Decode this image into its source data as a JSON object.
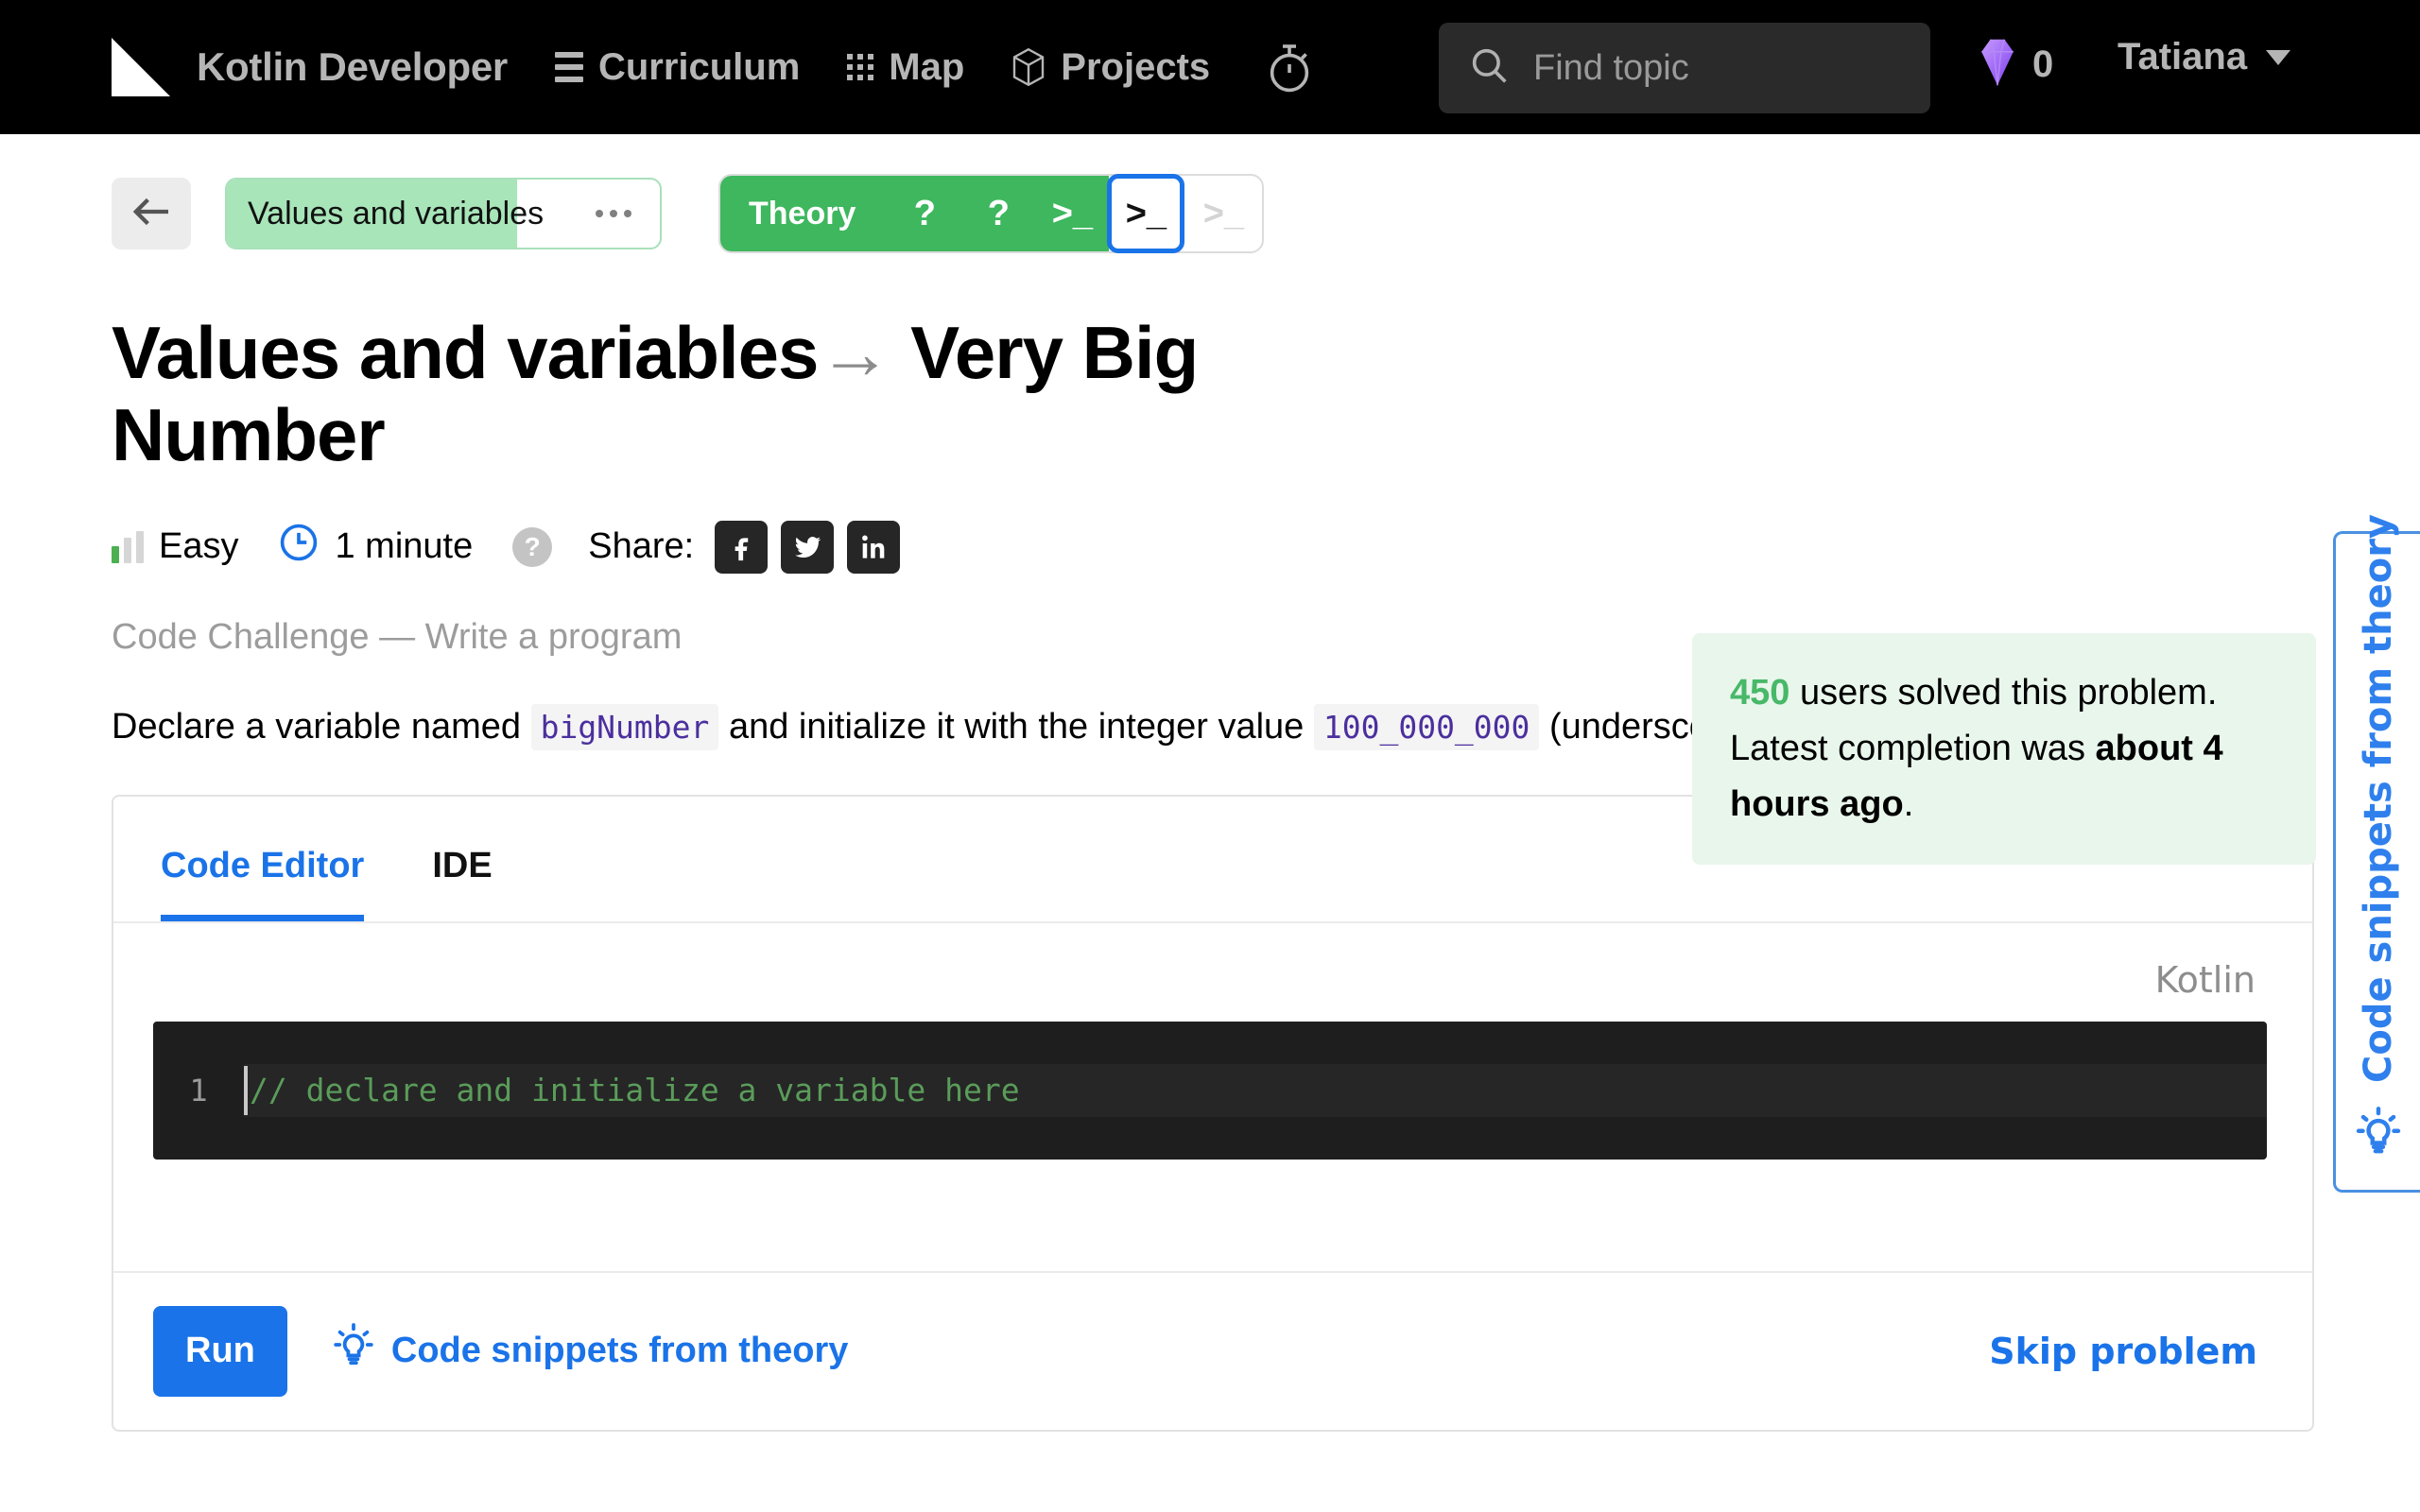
{
  "navbar": {
    "logo_icon": "hyperskill-logo-icon",
    "brand": "Kotlin Developer",
    "items": [
      {
        "label": "Curriculum",
        "icon": "hamburger-icon"
      },
      {
        "label": "Map",
        "icon": "grid-dots-icon"
      },
      {
        "label": "Projects",
        "icon": "cube-icon"
      }
    ],
    "timer_icon": "stopwatch-icon",
    "search": {
      "icon": "search-icon",
      "placeholder": "Find topic",
      "value": ""
    },
    "gems": {
      "icon": "gem-icon",
      "count": "0",
      "color": "#a368f0"
    },
    "user": {
      "name": "Tatiana",
      "caret_icon": "chevron-down-icon"
    }
  },
  "stepbar": {
    "back_icon": "arrow-left-icon",
    "topic_chip": {
      "label": "Values and variables",
      "progress_percent": 67,
      "more_icon": "ellipsis-icon"
    },
    "steps": {
      "theory_label": "Theory",
      "done_icons": [
        "question-mark-icon",
        "question-mark-icon",
        "terminal-prompt-icon"
      ],
      "current_icon": "terminal-prompt-icon",
      "next_icon": "terminal-prompt-icon"
    }
  },
  "main": {
    "title_topic": "Values and variables",
    "title_arrow": "→",
    "title_step": "Very Big Number",
    "meta": {
      "difficulty_icon": "difficulty-bars-icon",
      "difficulty": "Easy",
      "time_icon": "clock-icon",
      "time": "1 minute",
      "help_icon": "question-circle-icon",
      "share_label": "Share:",
      "share": [
        {
          "name": "facebook-icon",
          "glyph": "f"
        },
        {
          "name": "twitter-icon",
          "glyph": "t"
        },
        {
          "name": "linkedin-icon",
          "glyph": "in"
        }
      ]
    },
    "challenge_kind": "Code Challenge — Write a program",
    "task": {
      "part1": "Declare a variable named ",
      "code1": "bigNumber",
      "part2": " and initialize it with the integer value ",
      "code2": "100_000_000",
      "part3": " (underscores are admissible here)."
    }
  },
  "solved_box": {
    "count": "450",
    "text_mid": " users solved this problem. Latest completion was ",
    "when": "about 4 hours ago",
    "period": ".",
    "accent": "#48b869",
    "background": "#e9f6ec"
  },
  "editor": {
    "tabs": [
      {
        "label": "Code Editor",
        "active": true
      },
      {
        "label": "IDE",
        "active": false
      }
    ],
    "language": "Kotlin",
    "line_number": "1",
    "code": "// declare and initialize a variable here",
    "code_color": "#5a9c5a",
    "footer": {
      "run_label": "Run",
      "snippets_icon": "lightbulb-icon",
      "snippets_label": "Code snippets from theory",
      "skip_label": "Skip problem"
    }
  },
  "side_tab": {
    "label": "Code snippets from theory",
    "icon": "lightbulb-icon",
    "accent": "#2f80ed"
  }
}
